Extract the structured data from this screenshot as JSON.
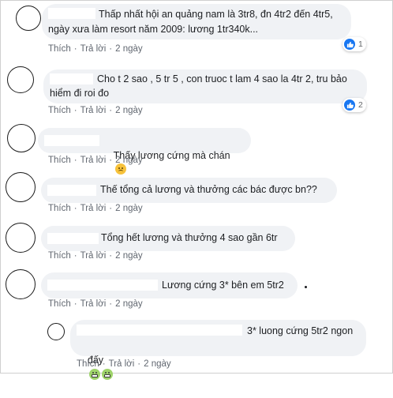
{
  "comments": [
    {
      "lines": [
        "Thấp nhất hội an quảng nam là 3tr8, đn 4tr2 đến 4tr5,",
        "ngày xưa làm resort năm 2009: lương 1tr340k..."
      ],
      "like": "Thích",
      "reply": "Trả lời",
      "time": "2 ngày",
      "reactions": "1"
    },
    {
      "lines": [
        "Cho t 2 sao , 5 tr 5 , con truoc t lam 4 sao la 4tr 2, tru bảo",
        "hiểm đi roi đo"
      ],
      "like": "Thích",
      "reply": "Trả lời",
      "time": "2 ngày",
      "reactions": "2"
    },
    {
      "lines": [
        "Thấy lương cứng mà chán"
      ],
      "emoji": "sad-face-icon",
      "like": "Thích",
      "reply": "Trả lời",
      "time": "2 ngày"
    },
    {
      "lines": [
        "Thế tổng cả lương và thưởng các bác được bn??"
      ],
      "like": "Thích",
      "reply": "Trả lời",
      "time": "2 ngày"
    },
    {
      "lines": [
        "Tổng hết lương và thưởng 4 sao gần 6tr"
      ],
      "like": "Thích",
      "reply": "Trả lời",
      "time": "2 ngày"
    },
    {
      "lines": [
        "Lương cứng 3* bên em 5tr2"
      ],
      "like": "Thích",
      "reply": "Trả lời",
      "time": "2 ngày"
    }
  ],
  "reply": {
    "lines": [
      "3* luong cứng 5tr2 ngon",
      "đấy"
    ],
    "emoji": "grimace-face-icon",
    "like": "Thích",
    "reply": "Trả lời",
    "time": "2 ngày"
  },
  "separator": "·",
  "colors": {
    "bubble": "#f0f2f5",
    "like_blue": "#1877f2",
    "meta": "#616770"
  }
}
